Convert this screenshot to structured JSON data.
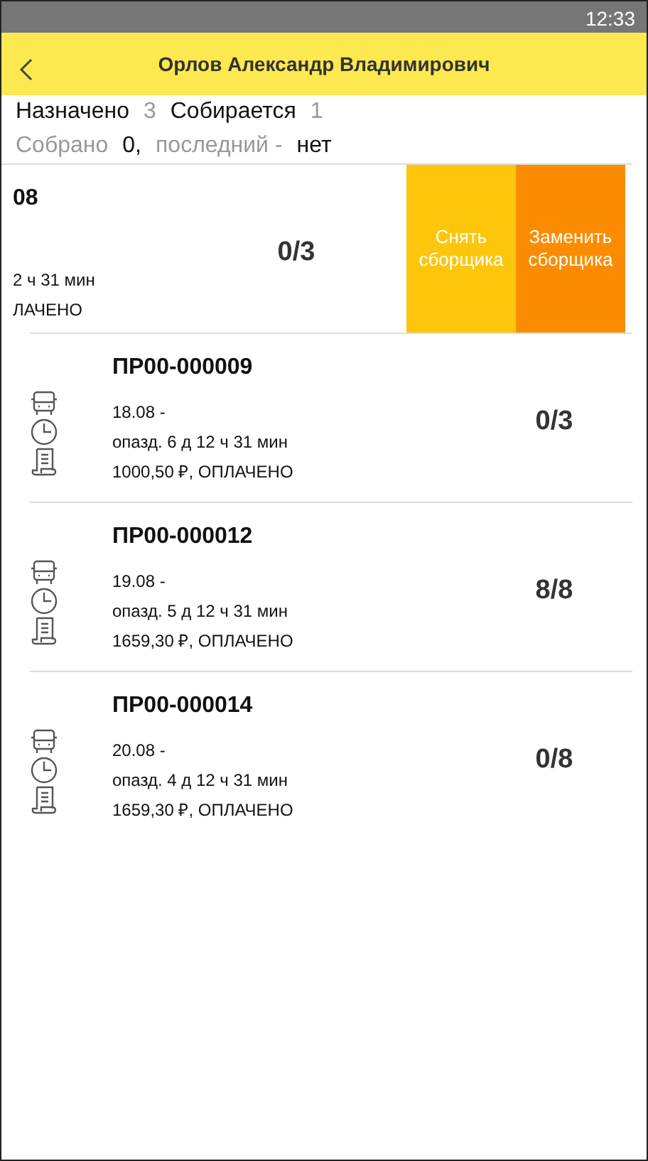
{
  "status_bar": {
    "time": "12:33"
  },
  "header": {
    "title": "Орлов Александр Владимирович"
  },
  "summary": [
    [
      {
        "text": "Назначено",
        "muted": false
      },
      {
        "text": "3",
        "muted": true
      },
      {
        "text": "Собирается",
        "muted": false
      },
      {
        "text": "1",
        "muted": true
      }
    ],
    [
      {
        "text": "Собрано",
        "muted": true
      },
      {
        "text": "0,",
        "muted": false
      },
      {
        "text": "последний -",
        "muted": true
      },
      {
        "text": "нет",
        "muted": false
      }
    ]
  ],
  "orders": [
    {
      "number": "08",
      "delay": "2 ч 31 мин",
      "payment": "ЛАЧЕНО",
      "progress": "0/3",
      "swiped": true,
      "actions": [
        {
          "label": "Снять сборщика",
          "kind": "remove"
        },
        {
          "label": "Заменить сборщика",
          "kind": "replace"
        }
      ]
    },
    {
      "number": "ПР00-000009",
      "date": "18.08  -",
      "delay": "опазд.  6 д 12 ч 31 мин",
      "payment": "1000,50 ₽, ОПЛАЧЕНО",
      "progress": "0/3",
      "swiped": false
    },
    {
      "number": "ПР00-000012",
      "date": "19.08  -",
      "delay": "опазд.  5 д 12 ч 31 мин",
      "payment": "1659,30 ₽, ОПЛАЧЕНО",
      "progress": "8/8",
      "swiped": false
    },
    {
      "number": "ПР00-000014",
      "date": "20.08  -",
      "delay": "опазд.  4 д 12 ч 31 мин",
      "payment": "1659,30 ₽, ОПЛАЧЕНО",
      "progress": "0/8",
      "swiped": false
    }
  ]
}
